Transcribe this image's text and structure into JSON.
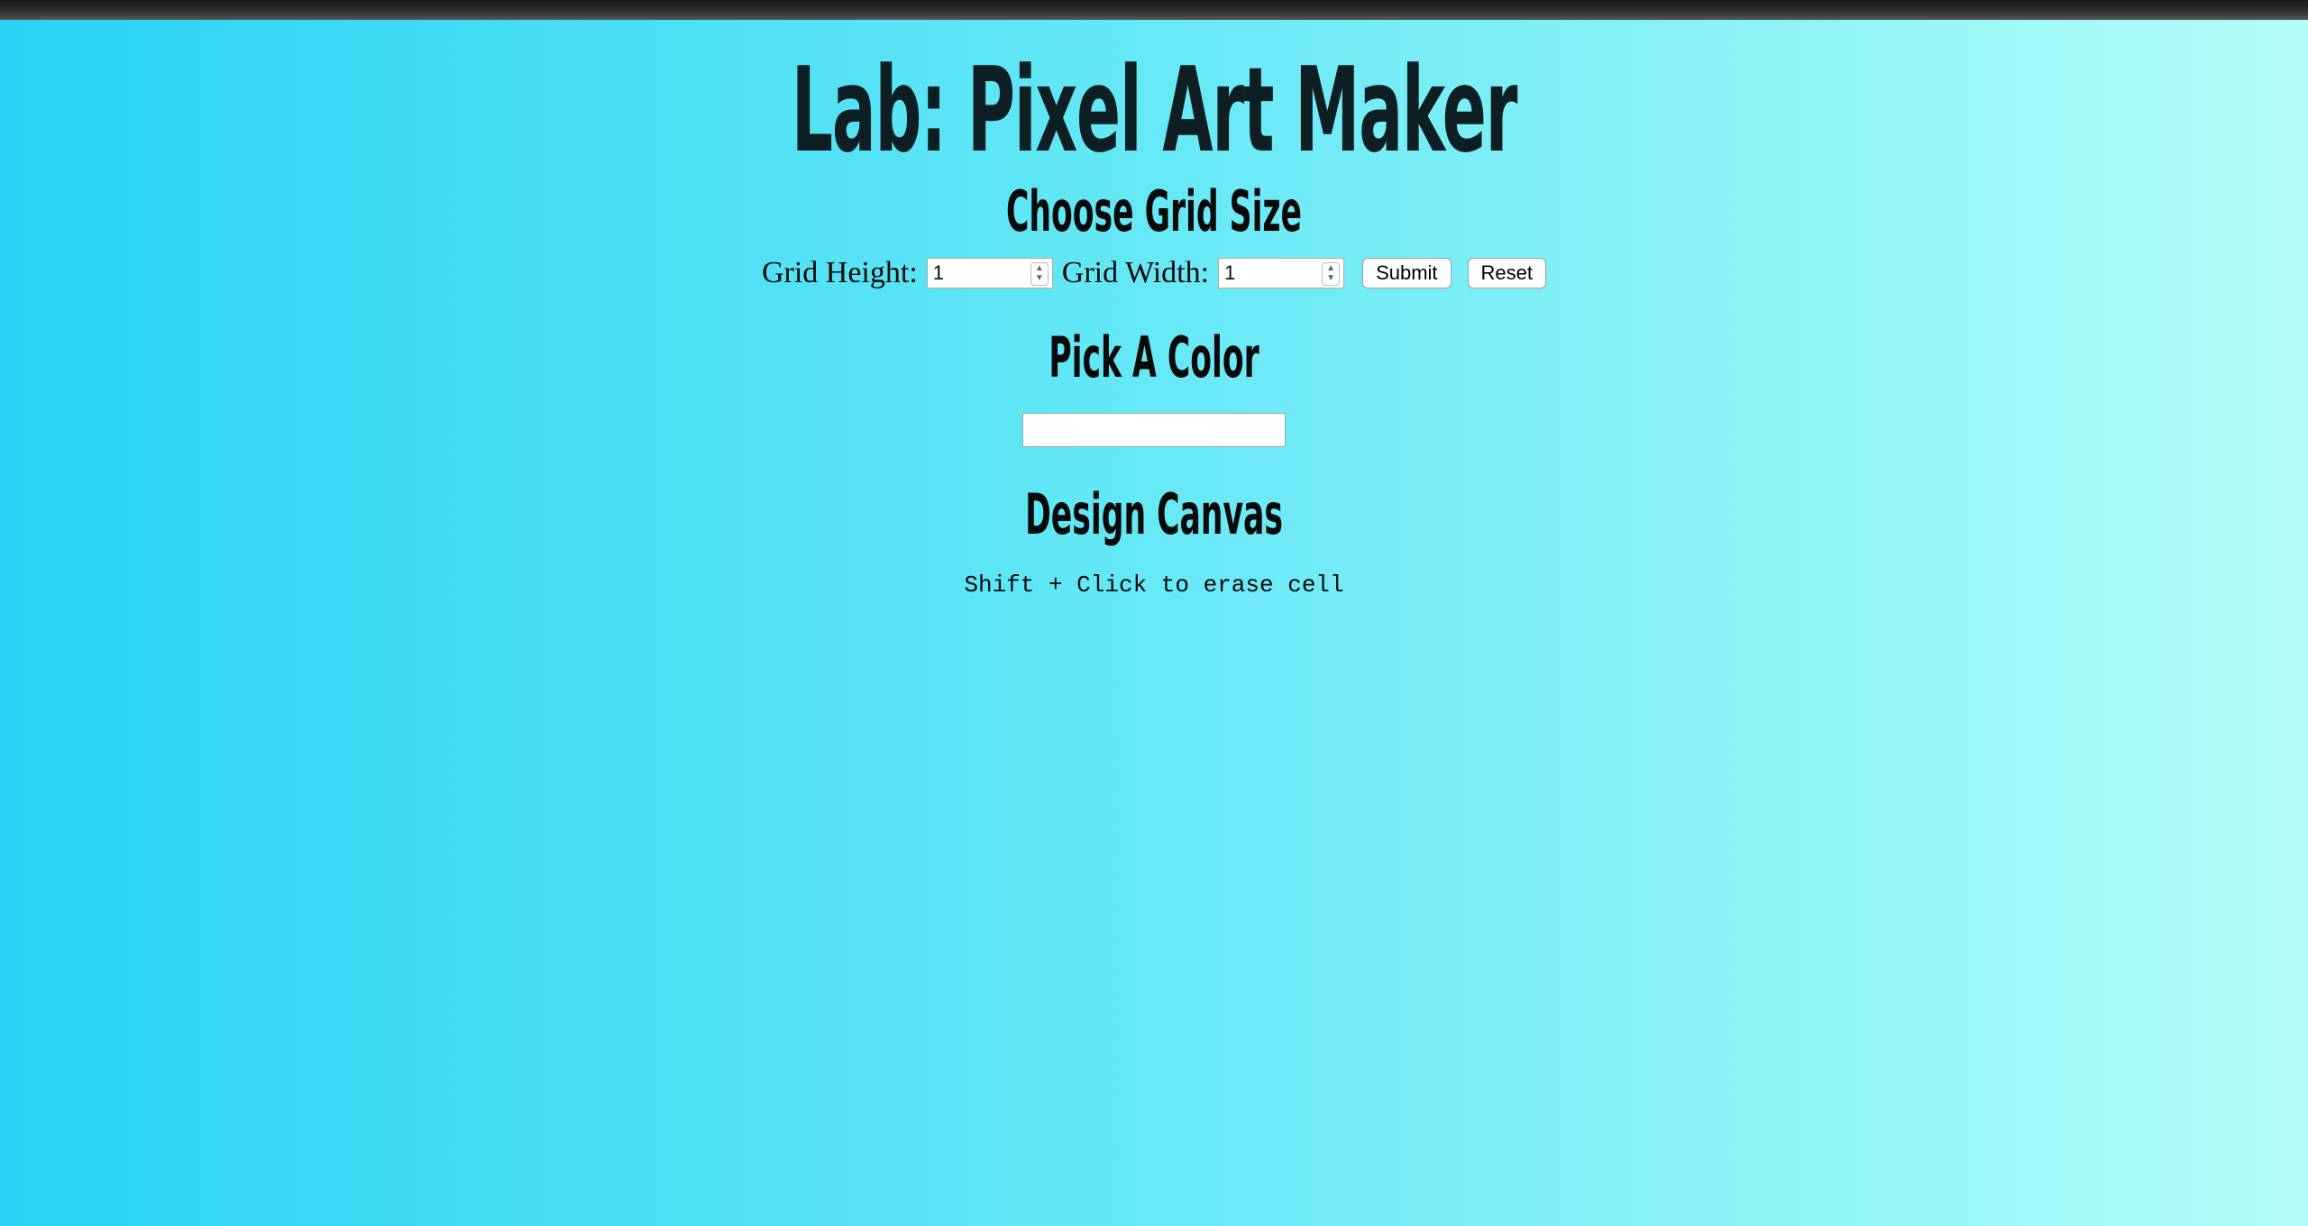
{
  "page": {
    "title": "Lab: Pixel Art Maker"
  },
  "grid_size": {
    "heading": "Choose Grid Size",
    "height_label": "Grid Height:",
    "height_value": "1",
    "width_label": "Grid Width:",
    "width_value": "1",
    "submit_label": "Submit",
    "reset_label": "Reset"
  },
  "color": {
    "heading": "Pick A Color",
    "value": "#ffffff"
  },
  "canvas": {
    "heading": "Design Canvas",
    "hint": "Shift + Click to erase cell"
  },
  "colors": {
    "gradient_left": "#29d3f5",
    "gradient_right": "#b2fdf8",
    "title_text": "#0d1f23"
  }
}
